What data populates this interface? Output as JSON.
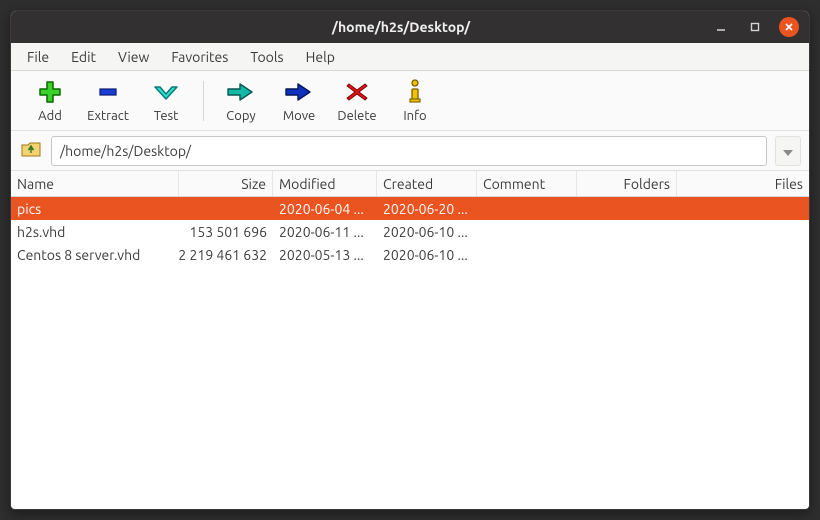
{
  "window": {
    "title": "/home/h2s/Desktop/"
  },
  "menubar": {
    "items": [
      "File",
      "Edit",
      "View",
      "Favorites",
      "Tools",
      "Help"
    ]
  },
  "toolbar": {
    "add": {
      "label": "Add"
    },
    "extract": {
      "label": "Extract"
    },
    "test": {
      "label": "Test"
    },
    "copy": {
      "label": "Copy"
    },
    "move": {
      "label": "Move"
    },
    "delete": {
      "label": "Delete"
    },
    "info": {
      "label": "Info"
    }
  },
  "location": {
    "path": "/home/h2s/Desktop/"
  },
  "columns": {
    "name": "Name",
    "size": "Size",
    "modified": "Modified",
    "created": "Created",
    "comment": "Comment",
    "folders": "Folders",
    "files": "Files"
  },
  "files": [
    {
      "name": "pics",
      "size": "",
      "modified": "2020-06-04 ...",
      "created": "2020-06-20 ...",
      "selected": true
    },
    {
      "name": "h2s.vhd",
      "size": "153 501 696",
      "modified": "2020-06-11 ...",
      "created": "2020-06-10 ...",
      "selected": false
    },
    {
      "name": "Centos 8 server.vhd",
      "size": "2 219 461 632",
      "modified": "2020-05-13 ...",
      "created": "2020-06-10 ...",
      "selected": false
    }
  ]
}
